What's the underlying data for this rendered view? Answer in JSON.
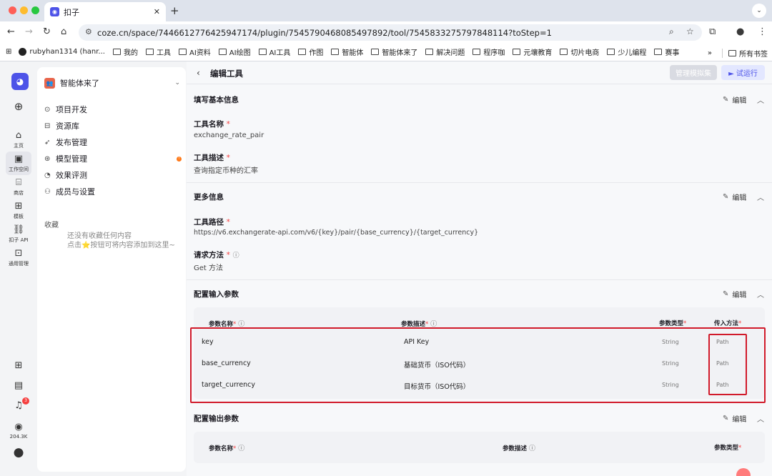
{
  "browser": {
    "tab_title": "扣子",
    "url": "coze.cn/space/7446612776425947174/plugin/7545790468085497892/tool/7545833275797848114?toStep=1",
    "bookmarks": [
      "rubyhan1314 (hanr...",
      "我的",
      "工具",
      "AI资料",
      "AI绘图",
      "AI工具",
      "作图",
      "智能体",
      "智能体来了",
      "解决问题",
      "程序咖",
      "元壤教育",
      "切片电商",
      "少儿编程",
      "赛事"
    ],
    "bookmarks_more": "»",
    "all_bookmarks": "所有书签"
  },
  "rail": {
    "create_icon": "plus-circle-icon",
    "items": [
      {
        "label": "主页",
        "icon": "home-icon"
      },
      {
        "label": "工作空间",
        "icon": "terminal-icon",
        "active": true
      },
      {
        "label": "商店",
        "icon": "store-icon"
      },
      {
        "label": "模板",
        "icon": "template-icon"
      },
      {
        "label": "扣子 API",
        "icon": "api-icon"
      },
      {
        "label": "通用管理",
        "icon": "manage-icon"
      }
    ],
    "notification_count": "3",
    "points": "204.3K"
  },
  "sidebar": {
    "workspace_name": "智能体来了",
    "menu": [
      {
        "label": "项目开发",
        "icon": "project-icon"
      },
      {
        "label": "资源库",
        "icon": "library-icon"
      },
      {
        "label": "发布管理",
        "icon": "rocket-icon"
      },
      {
        "label": "模型管理",
        "icon": "model-icon",
        "badge": "!"
      },
      {
        "label": "效果评测",
        "icon": "evaluate-icon"
      },
      {
        "label": "成员与设置",
        "icon": "members-icon"
      }
    ],
    "favorites_title": "收藏",
    "favorites_empty_1": "还没有收藏任何内容",
    "favorites_empty_2": "点击⭐按钮可将内容添加到这里~"
  },
  "header": {
    "title": "编辑工具",
    "manage_mock_label": "管理模拟集",
    "run_label": "► 试运行"
  },
  "edit_label": "编辑",
  "basic": {
    "title": "填写基本信息",
    "name_label": "工具名称",
    "name_value": "exchange_rate_pair",
    "desc_label": "工具描述",
    "desc_value": "查询指定币种的汇率"
  },
  "more": {
    "title": "更多信息",
    "path_label": "工具路径",
    "path_value": "https://v6.exchangerate-api.com/v6/{key}/pair/{base_currency}/{target_currency}",
    "method_label": "请求方法",
    "method_value": "Get 方法"
  },
  "input_params": {
    "title": "配置输入参数",
    "headers": {
      "name": "参数名称",
      "desc": "参数描述",
      "type": "参数类型",
      "method": "传入方法"
    },
    "rows": [
      {
        "name": "key",
        "desc": "API Key",
        "type": "String",
        "method": "Path"
      },
      {
        "name": "base_currency",
        "desc": "基础货币（ISO代码）",
        "type": "String",
        "method": "Path"
      },
      {
        "name": "target_currency",
        "desc": "目标货币（ISO代码）",
        "type": "String",
        "method": "Path"
      }
    ]
  },
  "output_params": {
    "title": "配置输出参数",
    "headers": {
      "name": "参数名称",
      "desc": "参数描述",
      "type": "参数类型"
    }
  },
  "colors": {
    "accent": "#4d53e8",
    "highlight": "#d11a2a",
    "required": "#f53f3f"
  }
}
